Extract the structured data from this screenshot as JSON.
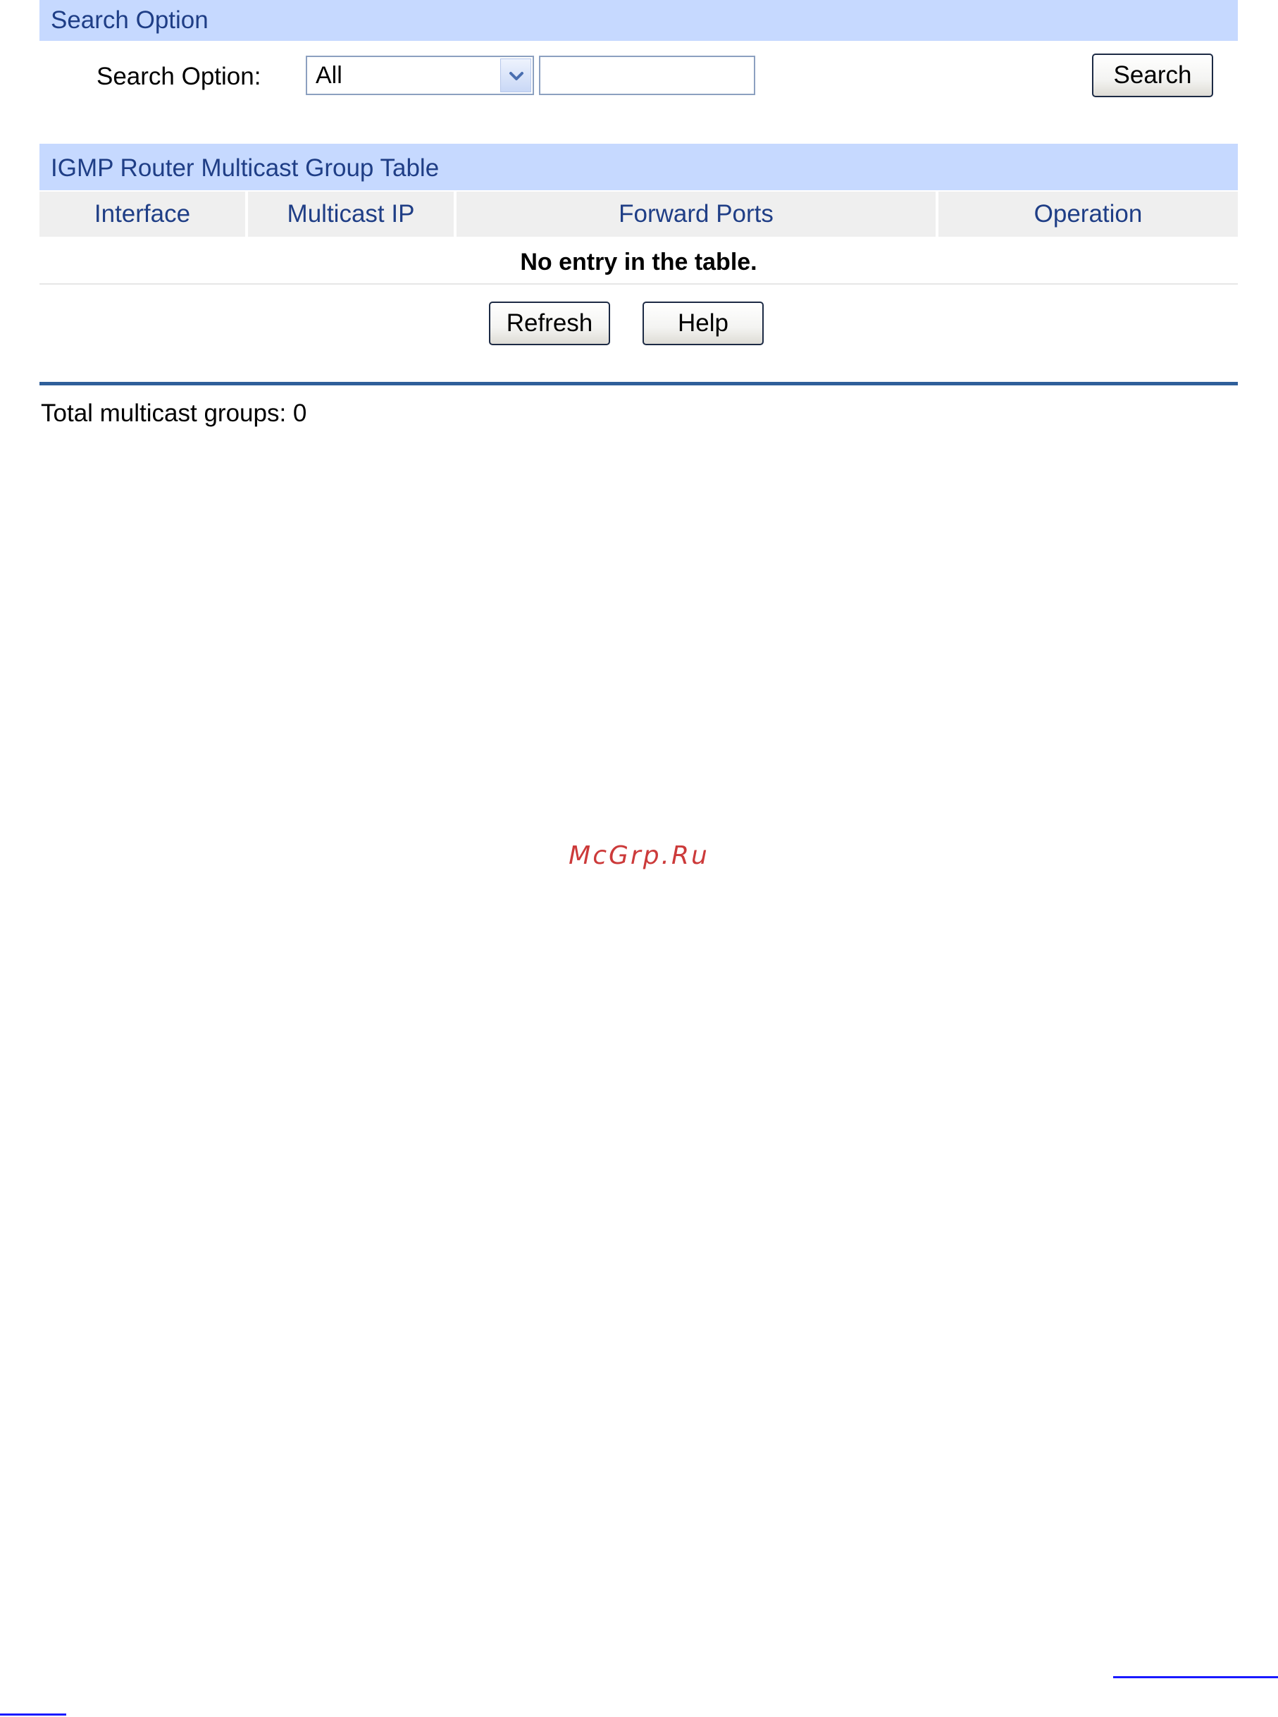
{
  "search_panel": {
    "title": "Search Option",
    "label": "Search Option:",
    "select": {
      "selected": "All",
      "options": [
        "All"
      ]
    },
    "text_value": "",
    "search_button": "Search"
  },
  "table_panel": {
    "title": "IGMP Router Multicast Group Table",
    "columns": [
      "Interface",
      "Multicast IP",
      "Forward Ports",
      "Operation"
    ],
    "rows": [],
    "empty_message": "No entry in the table.",
    "refresh_button": "Refresh",
    "help_button": "Help"
  },
  "summary": {
    "total_text": "Total multicast groups: 0"
  },
  "watermark": "McGrp.Ru",
  "colors": {
    "header_bg": "#c6d9ff",
    "header_text": "#1f3e86",
    "column_bg": "#efefef",
    "divider": "#2f5f9a",
    "watermark": "#cc3a3a",
    "link_underline": "#1a1aff"
  },
  "icons": {
    "select_arrow": "chevron-down-icon"
  }
}
